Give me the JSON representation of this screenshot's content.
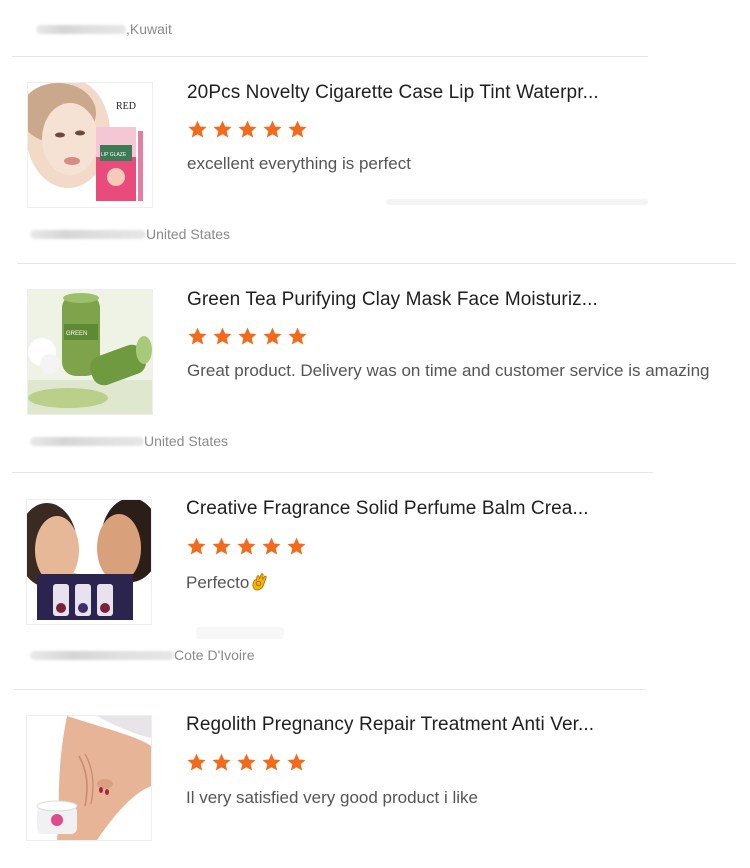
{
  "header": {
    "country": ",Kuwait"
  },
  "reviews": [
    {
      "title": "20Pcs Novelty Cigarette Case Lip Tint Waterpr...",
      "rating": 5,
      "text": "excellent everything is perfect",
      "country": "United States",
      "image_label": "RED",
      "image_box_text": "LIP GLAZE"
    },
    {
      "title": "Green Tea Purifying Clay Mask Face Moisturiz...",
      "rating": 5,
      "text": "Great product. Delivery was on time and customer service is amazing",
      "country": "United States",
      "image_box_text": "GREEN"
    },
    {
      "title": "Creative Fragrance Solid Perfume Balm Crea...",
      "rating": 5,
      "text": "Perfecto",
      "country": "Cote D'Ivoire"
    },
    {
      "title": "Regolith Pregnancy Repair Treatment Anti Ver...",
      "rating": 5,
      "text": "Il very satisfied very good product i like"
    }
  ],
  "colors": {
    "star": "#f26b1d",
    "divider": "#e6e6e6",
    "meta_text": "#8a8a8a"
  }
}
